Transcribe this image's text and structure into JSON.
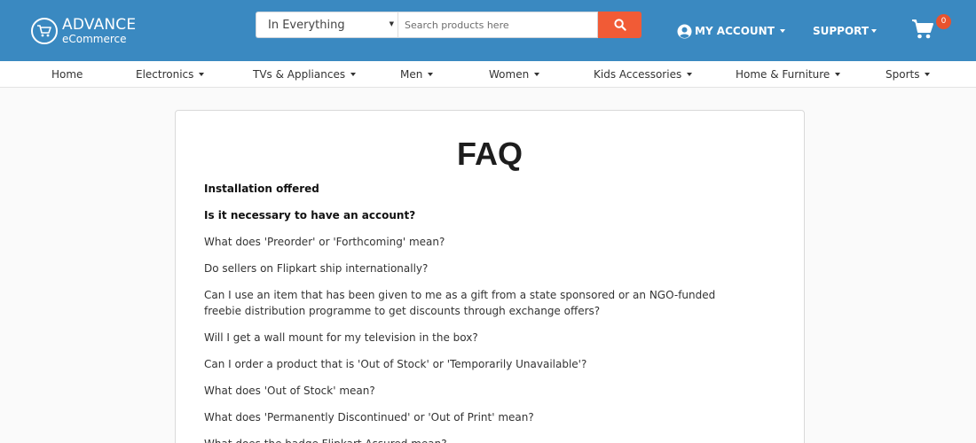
{
  "header": {
    "logo": {
      "line1": "ADVANCE",
      "line2": "eCommerce"
    },
    "search": {
      "category": "In Everything",
      "placeholder": "Search products here"
    },
    "account_label": "MY ACCOUNT",
    "support_label": "SUPPORT",
    "cart_count": "0"
  },
  "nav": [
    {
      "label": "Home",
      "has_dropdown": false
    },
    {
      "label": "Electronics",
      "has_dropdown": true
    },
    {
      "label": "TVs & Appliances",
      "has_dropdown": true
    },
    {
      "label": "Men",
      "has_dropdown": true
    },
    {
      "label": "Women",
      "has_dropdown": true
    },
    {
      "label": "Kids Accessories",
      "has_dropdown": true
    },
    {
      "label": "Home & Furniture",
      "has_dropdown": true
    },
    {
      "label": "Sports",
      "has_dropdown": true
    }
  ],
  "faq": {
    "title": "FAQ",
    "items": [
      {
        "text": "Installation offered",
        "bold": true
      },
      {
        "text": "Is it necessary to have an account?",
        "bold": true
      },
      {
        "text": "What does 'Preorder' or 'Forthcoming' mean?",
        "bold": false
      },
      {
        "text": "Do sellers on Flipkart ship internationally?",
        "bold": false
      },
      {
        "text": "Can I use an item that has been given to me as a gift from a state sponsored or an NGO-funded freebie distribution programme to get discounts through exchange offers?",
        "bold": false
      },
      {
        "text": "Will I get a wall mount for my television in the box?",
        "bold": false
      },
      {
        "text": "Can I order a product that is 'Out of Stock' or 'Temporarily Unavailable'?",
        "bold": false
      },
      {
        "text": "What does 'Out of Stock' mean?",
        "bold": false
      },
      {
        "text": "What does 'Permanently Discontinued' or 'Out of Print' mean?",
        "bold": false
      },
      {
        "text": "What does the badge Flipkart Assured mean?",
        "bold": false
      }
    ]
  },
  "colors": {
    "header_bg": "#3a89c1",
    "search_button": "#f15b36",
    "cart_badge": "#e8532f"
  },
  "icons": [
    "cart-logo-icon",
    "search-icon",
    "user-circle-icon",
    "shopping-cart-icon",
    "caret-down-icon"
  ]
}
